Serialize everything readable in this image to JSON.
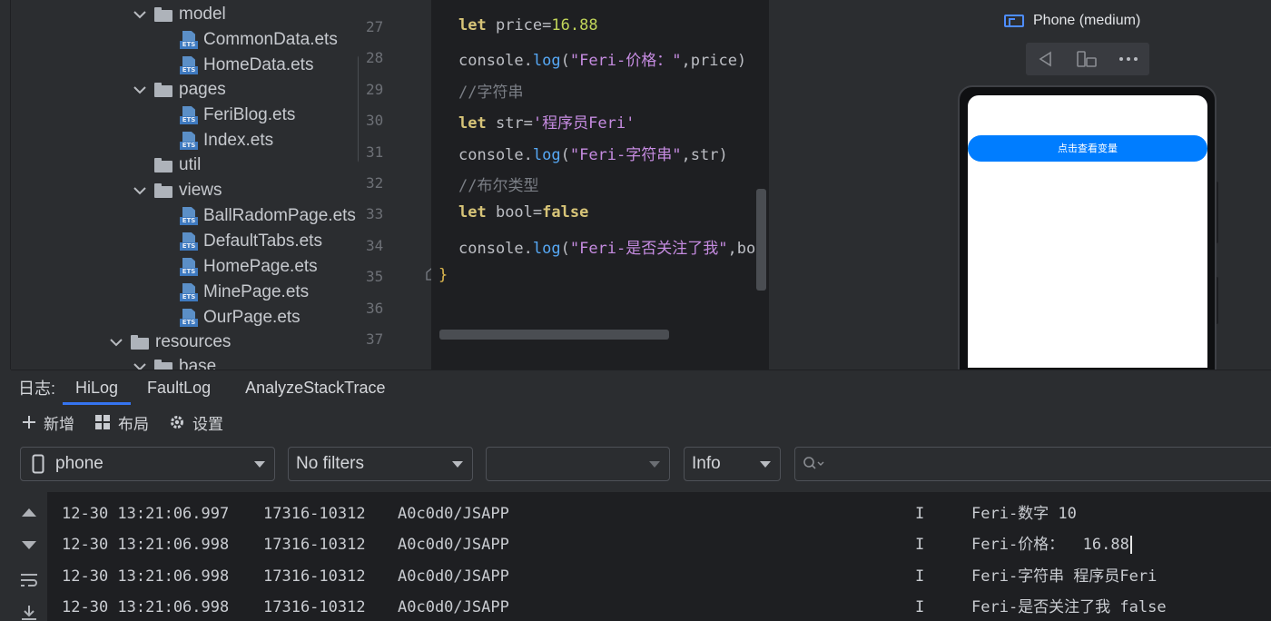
{
  "tree": {
    "items": [
      {
        "label": "model",
        "kind": "folder",
        "expanded": true
      },
      {
        "label": "CommonData.ets",
        "kind": "file"
      },
      {
        "label": "HomeData.ets",
        "kind": "file"
      },
      {
        "label": "pages",
        "kind": "folder",
        "expanded": true
      },
      {
        "label": "FeriBlog.ets",
        "kind": "file"
      },
      {
        "label": "Index.ets",
        "kind": "file"
      },
      {
        "label": "util",
        "kind": "folder",
        "expanded": false
      },
      {
        "label": "views",
        "kind": "folder",
        "expanded": true
      },
      {
        "label": "BallRadomPage.ets",
        "kind": "file"
      },
      {
        "label": "DefaultTabs.ets",
        "kind": "file"
      },
      {
        "label": "HomePage.ets",
        "kind": "file"
      },
      {
        "label": "MinePage.ets",
        "kind": "file"
      },
      {
        "label": "OurPage.ets",
        "kind": "file"
      },
      {
        "label": "resources",
        "kind": "folder",
        "expanded": true
      },
      {
        "label": "base",
        "kind": "folder",
        "expanded": true
      }
    ],
    "file_badge": "ETS"
  },
  "editor": {
    "line_numbers": [
      "27",
      "28",
      "29",
      "30",
      "31",
      "32",
      "33",
      "34",
      "35",
      "36",
      "37"
    ],
    "lines": {
      "l27": {
        "kw": "let",
        "name": " price=",
        "num": "16.88"
      },
      "l28": {
        "obj": "console.",
        "fn": "log",
        "open": "(",
        "str": "\"Feri-价格：\"",
        "rest": ",price)"
      },
      "l29": {
        "comment": "//字符串"
      },
      "l30": {
        "kw": "let",
        "name": " str=",
        "str": "'程序员Feri'"
      },
      "l31": {
        "obj": "console.",
        "fn": "log",
        "open": "(",
        "str": "\"Feri-字符串\"",
        "rest": ",str)"
      },
      "l32": {
        "comment": "//布尔类型"
      },
      "l33": {
        "kw": "let",
        "name": " bool=",
        "val": "false"
      },
      "l34": {
        "obj": "console.",
        "fn": "log",
        "open": "(",
        "str": "\"Feri-是否关注了我\"",
        "rest": ",boo"
      },
      "l35": {
        "brace": "}"
      }
    }
  },
  "preview": {
    "device_label": "Phone (medium)",
    "app_button_label": "点击查看变量"
  },
  "log": {
    "tabs_prefix": "日志:",
    "tabs": [
      "HiLog",
      "FaultLog",
      "AnalyzeStackTrace"
    ],
    "active_tab": "HiLog",
    "toolbar": {
      "add": "新增",
      "layout": "布局",
      "settings": "设置"
    },
    "filters": {
      "device": "phone",
      "filter": "No filters",
      "process": "",
      "level": "Info",
      "search_placeholder": ""
    },
    "rows": [
      {
        "time": "12-30 13:21:06.997",
        "pid": "17316-10312",
        "tag": "A0c0d0/JSAPP",
        "level": "I",
        "msg": "Feri-数字 10"
      },
      {
        "time": "12-30 13:21:06.998",
        "pid": "17316-10312",
        "tag": "A0c0d0/JSAPP",
        "level": "I",
        "msg": "Feri-价格：  16.88"
      },
      {
        "time": "12-30 13:21:06.998",
        "pid": "17316-10312",
        "tag": "A0c0d0/JSAPP",
        "level": "I",
        "msg": "Feri-字符串 程序员Feri"
      },
      {
        "time": "12-30 13:21:06.998",
        "pid": "17316-10312",
        "tag": "A0c0d0/JSAPP",
        "level": "I",
        "msg": "Feri-是否关注了我 false"
      }
    ]
  },
  "colors": {
    "accent": "#3574f0",
    "app_button": "#007dff",
    "keyword": "#d7c478",
    "string": "#c58be0",
    "number": "#c1d55a",
    "function": "#56a8f5"
  }
}
